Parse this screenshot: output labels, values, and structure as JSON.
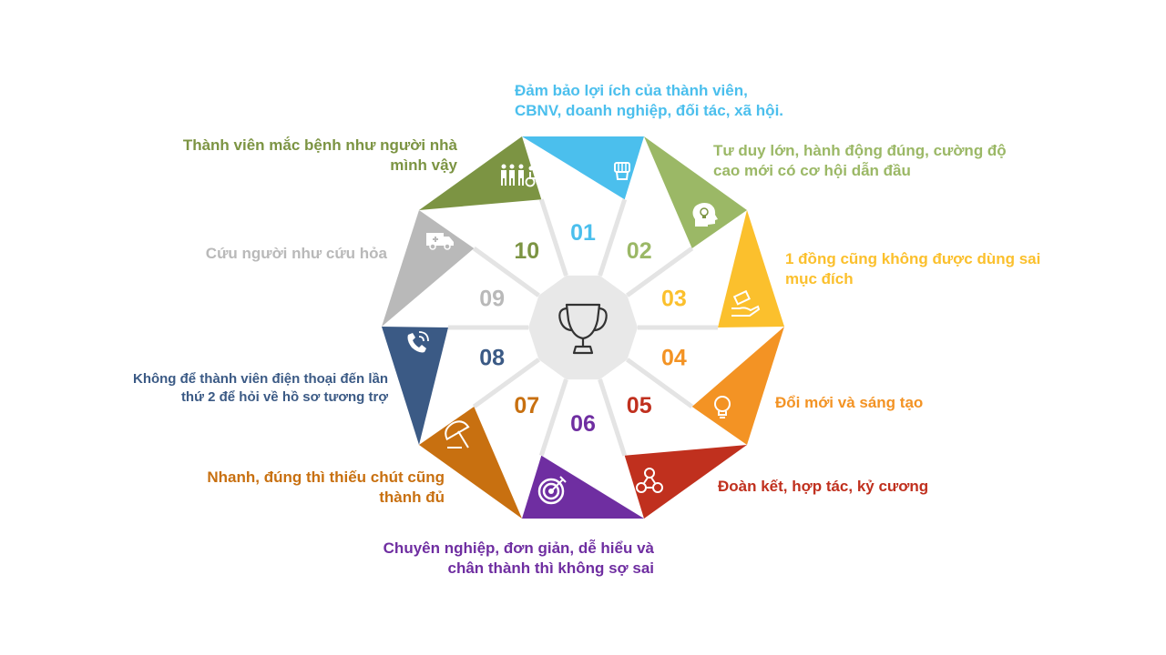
{
  "center_icon": "trophy-icon",
  "segments": [
    {
      "number": "01",
      "color": "#4bbfed",
      "icon": "fist-icon",
      "lines": [
        "Đảm bảo lợi ích của thành viên,",
        "CBNV, doanh nghiệp, đối tác, xã hội."
      ]
    },
    {
      "number": "02",
      "color": "#9bb866",
      "icon": "head-lightbulb-icon",
      "lines": [
        "Tư duy lớn, hành động đúng, cường độ",
        "cao mới có cơ hội dẫn đầu"
      ]
    },
    {
      "number": "03",
      "color": "#fbc02d",
      "icon": "hand-money-icon",
      "lines": [
        "1 đồng cũng không được dùng sai",
        "mục đích"
      ]
    },
    {
      "number": "04",
      "color": "#f39324",
      "icon": "lightbulb-icon",
      "lines": [
        "Đổi mới và sáng tạo"
      ]
    },
    {
      "number": "05",
      "color": "#c0301e",
      "icon": "team-network-icon",
      "lines": [
        "Đoàn kết, hợp tác, kỷ cương"
      ]
    },
    {
      "number": "06",
      "color": "#6f2ea1",
      "icon": "target-icon",
      "lines": [
        "Chuyên nghiệp, đơn giản, dễ hiểu và",
        "chân thành thì không sợ sai"
      ]
    },
    {
      "number": "07",
      "color": "#c87010",
      "icon": "umbrella-icon",
      "lines": [
        "Nhanh, đúng thì thiếu chút cũng",
        "thành đủ"
      ]
    },
    {
      "number": "08",
      "color": "#3b5a85",
      "icon": "phone-icon",
      "lines": [
        "Không để thành viên điện thoại đến lần",
        "thứ 2 để hỏi về hồ sơ tương trợ"
      ]
    },
    {
      "number": "09",
      "color": "#b9b9b9",
      "icon": "ambulance-icon",
      "lines": [
        "Cứu người như cứu hỏa"
      ]
    },
    {
      "number": "10",
      "color": "#7c9443",
      "icon": "family-wheelchair-icon",
      "lines": [
        "Thành viên mắc bệnh như người nhà",
        "mình vậy"
      ]
    }
  ]
}
